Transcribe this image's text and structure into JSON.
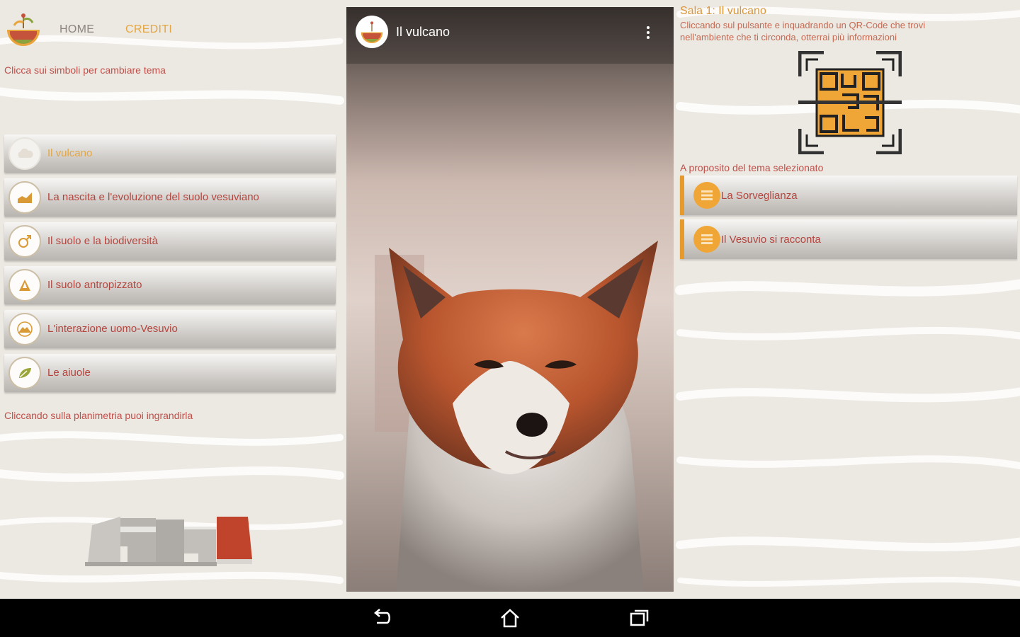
{
  "left": {
    "nav": {
      "home": "HOME",
      "credits": "CREDITI"
    },
    "hint_top": "Clicca sui simboli per cambiare tema",
    "themes": [
      {
        "label": "Il vulcano",
        "icon": "cloud-icon",
        "active": true
      },
      {
        "label": "La nascita e l'evoluzione del suolo vesuviano",
        "icon": "chart-icon",
        "active": false
      },
      {
        "label": "Il suolo e la biodiversità",
        "icon": "gender-icon",
        "active": false
      },
      {
        "label": "Il suolo antropizzato",
        "icon": "pyramid-icon",
        "active": false
      },
      {
        "label": "L'interazione uomo-Vesuvio",
        "icon": "volcano-icon",
        "active": false
      },
      {
        "label": "Le aiuole",
        "icon": "leaf-icon",
        "active": false
      }
    ],
    "hint_bottom": "Cliccando sulla planimetria puoi ingrandirla"
  },
  "center": {
    "title": "Il vulcano"
  },
  "right": {
    "title": "Sala 1: Il vulcano",
    "description": "Cliccando sul pulsante e inquadrando un QR-Code che trovi nell'ambiente che ti circonda, otterrai più informazioni",
    "subtitle": "A proposito del tema selezionato",
    "items": [
      {
        "label": "La Sorveglianza",
        "icon": "list-icon"
      },
      {
        "label": "Il Vesuvio si racconta",
        "icon": "list-icon"
      }
    ]
  },
  "colors": {
    "accent_orange": "#e69a2b",
    "label_red": "#b4453e",
    "background": "#ece8e2",
    "navbar": "#000000"
  }
}
